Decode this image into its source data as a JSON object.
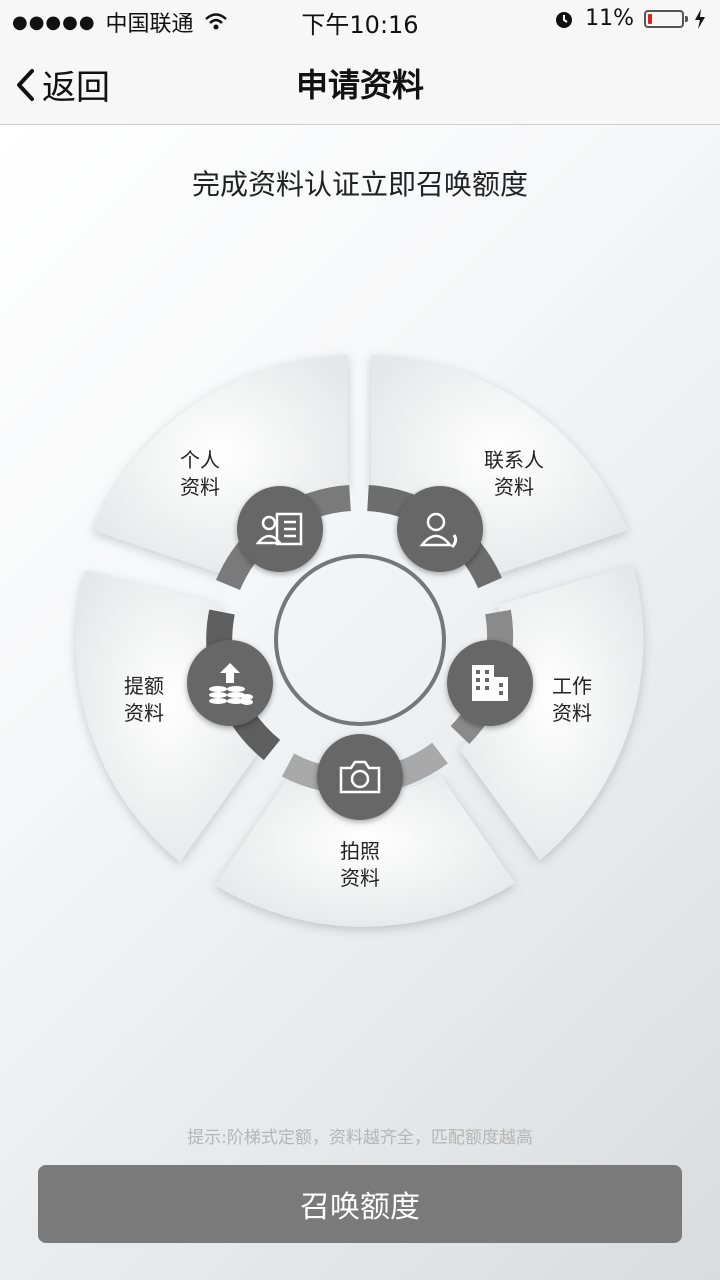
{
  "status": {
    "carrier": "中国联通",
    "time": "下午10:16",
    "battery": "11%"
  },
  "nav": {
    "back": "返回",
    "title": "申请资料"
  },
  "headline": "完成资料认证立即召唤额度",
  "items": {
    "personal": [
      "个人",
      "资料"
    ],
    "contact": [
      "联系人",
      "资料"
    ],
    "work": [
      "工作",
      "资料"
    ],
    "photo": [
      "拍照",
      "资料"
    ],
    "limit": [
      "提额",
      "资料"
    ]
  },
  "hint": "提示:阶梯式定额，资料越齐全，匹配额度越高",
  "button": "召唤额度",
  "colors": {
    "button": "#7a7a7a",
    "icon_bg": "#676767",
    "battery": "#e02020"
  }
}
